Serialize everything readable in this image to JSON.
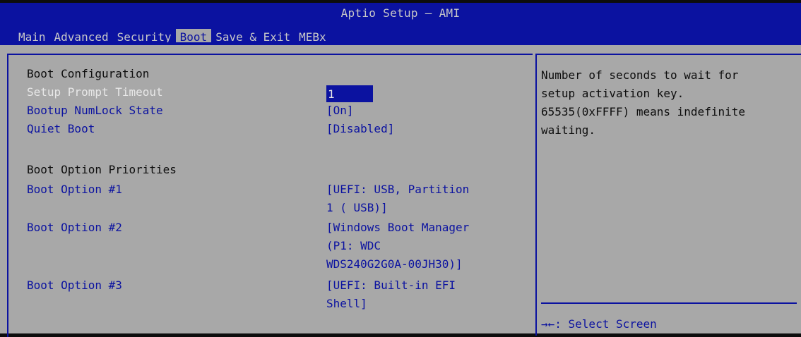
{
  "header": {
    "title": "Aptio Setup – AMI",
    "tabs": [
      "Main",
      "Advanced",
      "Security",
      "Boot",
      "Save & Exit",
      "MEBx"
    ],
    "active_tab": "Boot"
  },
  "main": {
    "boot_configuration_heading": "Boot Configuration",
    "setup_prompt_timeout": {
      "label": "Setup Prompt Timeout",
      "value": "1"
    },
    "bootup_numlock_state": {
      "label": "Bootup NumLock State",
      "value": "[On]"
    },
    "quiet_boot": {
      "label": "Quiet Boot",
      "value": "[Disabled]"
    },
    "boot_option_priorities_heading": "Boot Option Priorities",
    "boot_options": [
      {
        "label": "Boot Option #1",
        "value": "[UEFI:  USB, Partition\n1 ( USB)]"
      },
      {
        "label": "Boot Option #2",
        "value": "[Windows Boot Manager\n(P1: WDC\nWDS240G2G0A-00JH30)]"
      },
      {
        "label": "Boot Option #3",
        "value": "[UEFI: Built-in EFI\nShell]"
      }
    ]
  },
  "help": {
    "text": "Number of seconds to wait for\nsetup activation key.\n65535(0xFFFF) means indefinite\nwaiting.",
    "key_hint_arrows": "→←",
    "key_hint_text": ": Select Screen"
  },
  "colors": {
    "bios_blue": "#0b12a0",
    "panel_gray": "#a8a8a8",
    "highlight_text": "#e8e8e8"
  }
}
